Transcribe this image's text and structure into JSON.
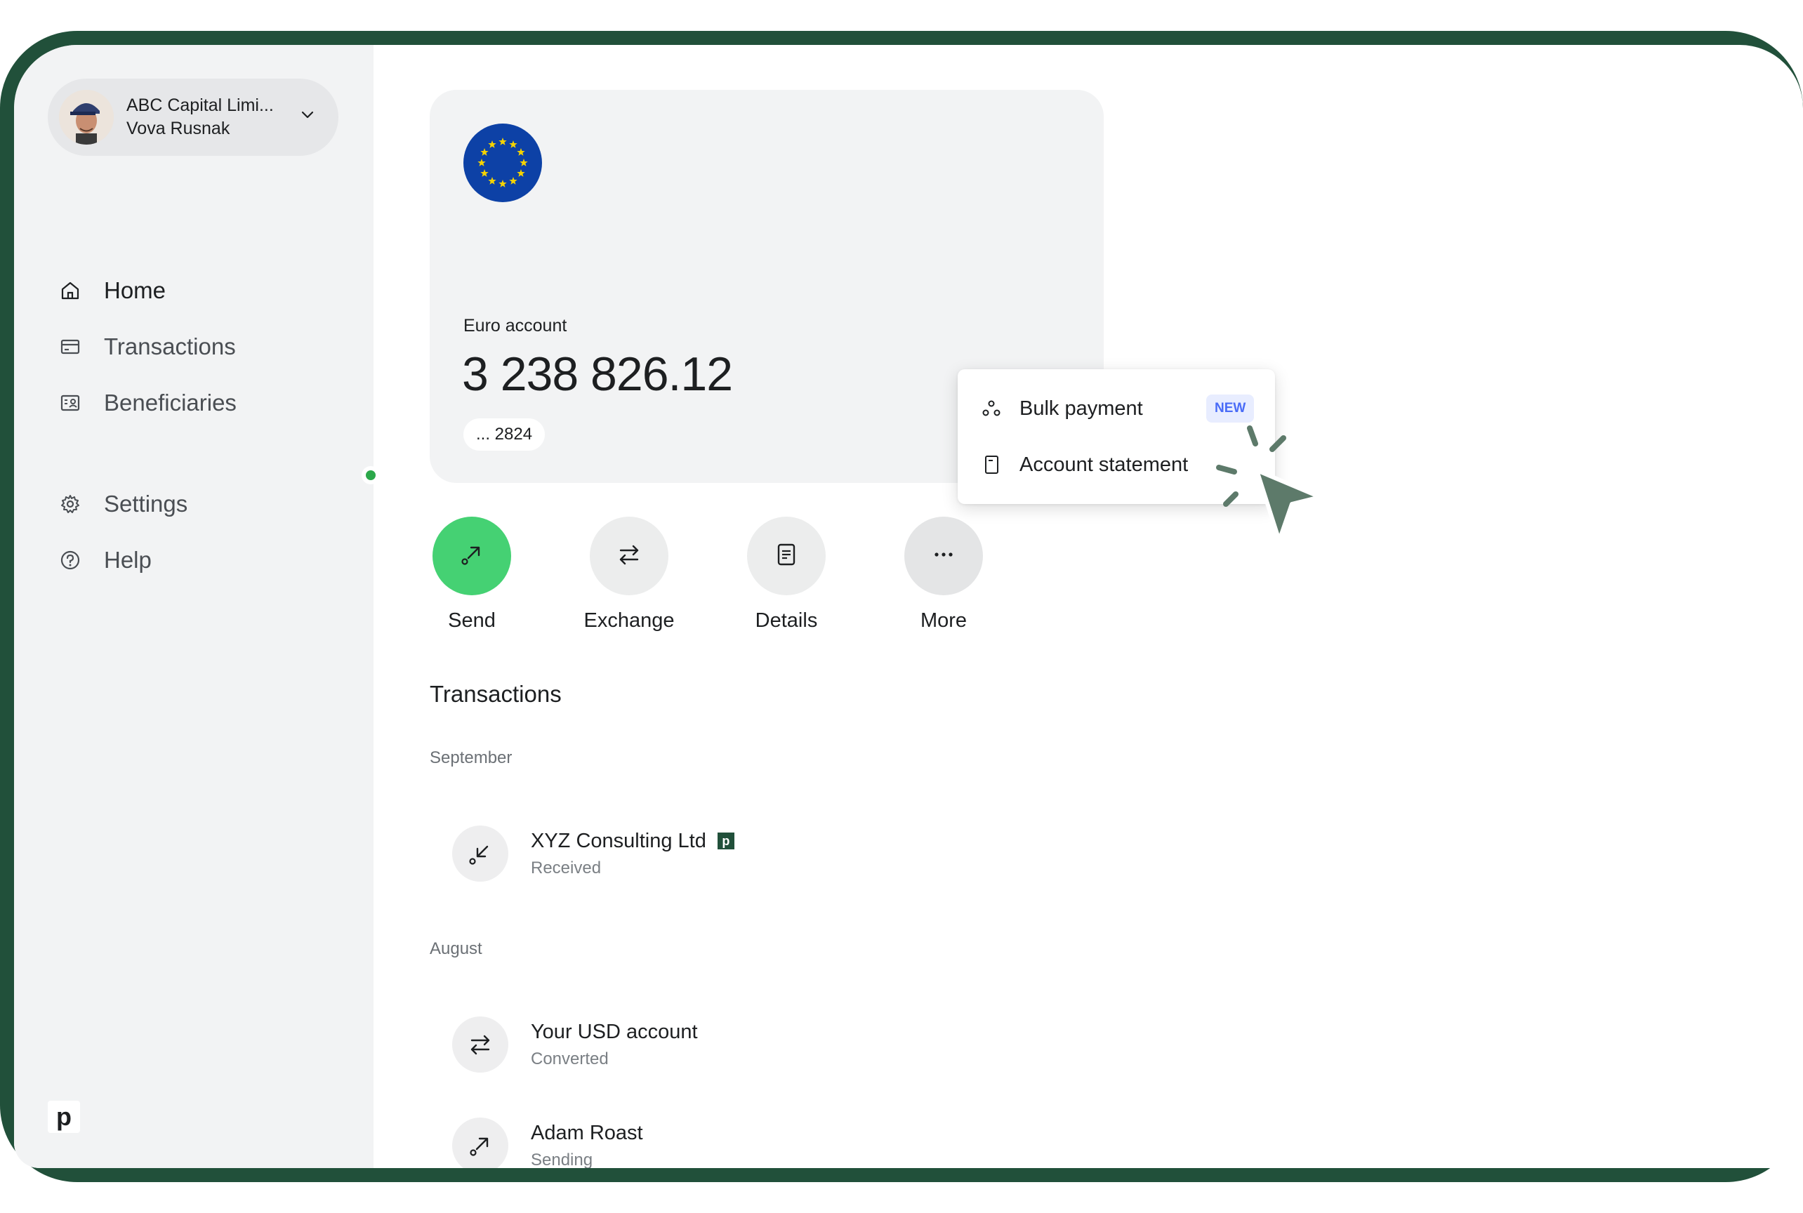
{
  "sidebar": {
    "account_switcher": {
      "org_name": "ABC Capital Limi...",
      "user_name": "Vova Rusnak"
    },
    "nav": [
      {
        "label": "Home",
        "icon": "home-icon",
        "active": true
      },
      {
        "label": "Transactions",
        "icon": "card-icon",
        "active": false
      },
      {
        "label": "Beneficiaries",
        "icon": "contact-card-icon",
        "active": false
      }
    ],
    "nav_secondary": [
      {
        "label": "Settings",
        "icon": "gear-icon"
      },
      {
        "label": "Help",
        "icon": "help-icon"
      }
    ],
    "logo_text": "p"
  },
  "account": {
    "flag": "eu-flag-icon",
    "label": "Euro account",
    "balance": "3 238 826.12",
    "number_mask": "... 2824"
  },
  "actions": [
    {
      "label": "Send",
      "icon": "send-arrow-icon"
    },
    {
      "label": "Exchange",
      "icon": "exchange-icon"
    },
    {
      "label": "Details",
      "icon": "document-icon"
    },
    {
      "label": "More",
      "icon": "ellipsis-icon"
    }
  ],
  "more_menu": {
    "items": [
      {
        "label": "Bulk payment",
        "icon": "bulk-payment-icon",
        "badge": "NEW"
      },
      {
        "label": "Account statement",
        "icon": "statement-icon"
      }
    ]
  },
  "transactions": {
    "title": "Transactions",
    "groups": [
      {
        "month": "September",
        "items": [
          {
            "name": "XYZ Consulting Ltd",
            "status": "Received",
            "badge": "p"
          }
        ]
      },
      {
        "month": "August",
        "items": [
          {
            "name": "Your USD account",
            "status": "Converted"
          },
          {
            "name": "Adam Roast",
            "status": "Sending"
          }
        ]
      }
    ]
  },
  "colors": {
    "frame": "#21503a",
    "send": "#45d173",
    "badge_new_bg": "#e8edff",
    "badge_new_text": "#4a6cf7",
    "cursor": "#5d7a6a"
  }
}
